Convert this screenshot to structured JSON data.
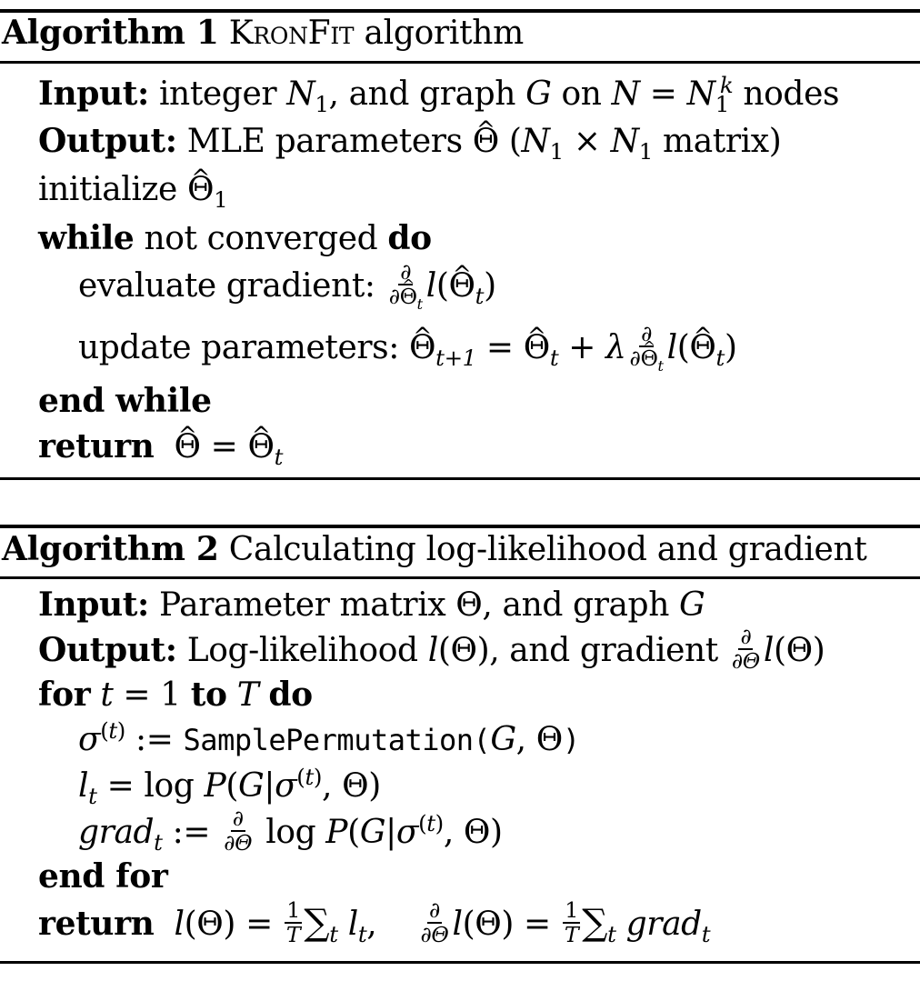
{
  "algorithm1": {
    "label": "Algorithm 1",
    "title": "KronFit algorithm",
    "title_smallcaps_a": "Kron",
    "title_smallcaps_b": "Fit",
    "title_rest": " algorithm",
    "lines": [
      {
        "keyword": "Input:",
        "text": " integer N₁, and graph G on N = N₁ᵏ nodes"
      },
      {
        "keyword": "Output:",
        "text": " MLE parameters Θ̂ (N₁ × N₁ matrix)"
      },
      {
        "text": "initialize Θ̂₁"
      },
      {
        "keyword": "while",
        "text": " not converged ",
        "keyword_end": "do"
      },
      {
        "text": "evaluate gradient: ∂/∂Θ̂ₜ l(Θ̂ₜ)"
      },
      {
        "text": "update parameters: Θ̂ₜ₊₁ = Θ̂ₜ + λ ∂/∂Θ̂ₜ l(Θ̂ₜ)"
      },
      {
        "keyword": "end while"
      },
      {
        "keyword": "return",
        "text": " Θ̂ = Θ̂ₜ"
      }
    ]
  },
  "algorithm2": {
    "label": "Algorithm 2",
    "title": "Calculating log-likelihood and gradient",
    "lines": [
      {
        "keyword": "Input:",
        "text": " Parameter matrix Θ, and graph G"
      },
      {
        "keyword": "Output:",
        "text": " Log-likelihood l(Θ), and gradient ∂/∂Θ l(Θ)"
      },
      {
        "keyword": "for",
        "text": " t = 1 ",
        "keyword_mid": "to",
        "text2": " T ",
        "keyword_end": "do"
      },
      {
        "text": "σ⁽ᵗ⁾ := SamplePermutation(G, Θ)"
      },
      {
        "text": "lₜ = log P(G|σ⁽ᵗ⁾, Θ)"
      },
      {
        "text": "gradₜ := ∂/∂Θ log P(G|σ⁽ᵗ⁾, Θ)"
      },
      {
        "keyword": "end for"
      },
      {
        "keyword": "return",
        "text": " l(Θ) = 1/T Σₜ lₜ,   ∂/∂Θ l(Θ) = 1/T Σₜ gradₜ"
      }
    ],
    "function_name": "SamplePermutation"
  },
  "tokens": {
    "input": "Input:",
    "output": "Output:",
    "while": "while",
    "do": "do",
    "end_while": "end while",
    "return": "return",
    "for": "for",
    "to": "to",
    "end_for": "end for",
    "integer": "integer",
    "and_graph": ", and graph",
    "on": "on",
    "nodes": "nodes",
    "mle_parameters": "MLE parameters",
    "matrix": "matrix)",
    "initialize": "initialize",
    "not_converged": "not converged",
    "evaluate_gradient": "evaluate gradient:",
    "update_parameters": "update parameters:",
    "parameter_matrix": "Parameter matrix",
    "and_graph2": ", and graph",
    "log_likelihood": "Log-likelihood",
    "and_gradient": ", and gradient",
    "log": "log",
    "sample_permutation": "SamplePermutation",
    "grad": "grad"
  }
}
